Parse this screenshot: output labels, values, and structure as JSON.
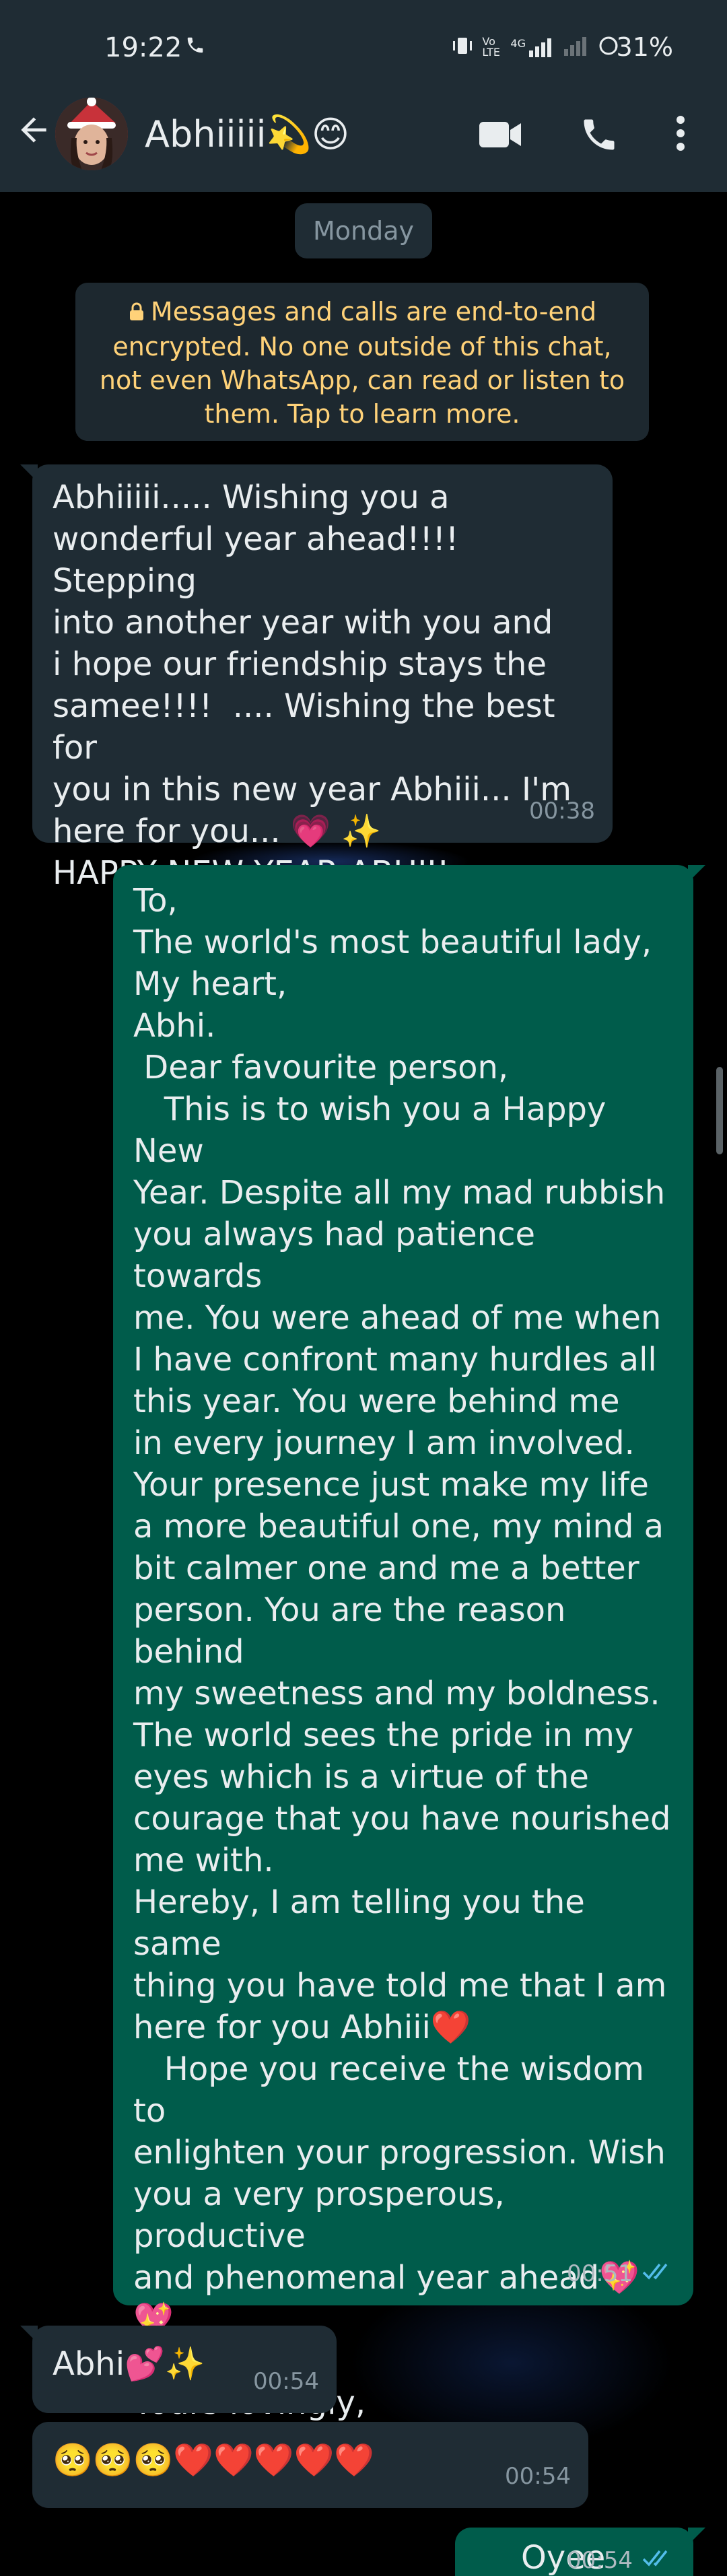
{
  "status_bar": {
    "time": "19:22",
    "network_label": "Vo LTE",
    "signal_label": "4G",
    "battery": "31%"
  },
  "header": {
    "contact_name": "Abhiiiii💫😊"
  },
  "chat": {
    "date_label": "Monday",
    "encryption_notice": "Messages and calls are end-to-end encrypted. No one outside of this chat, not even WhatsApp, can read or listen to them. Tap to learn more.",
    "messages": [
      {
        "direction": "in",
        "text": "Abhiiiii..... Wishing you a\nwonderful year ahead!!!! Stepping\ninto another year with you and\ni hope our friendship stays the\nsamee!!!!  .... Wishing the best for\nyou in this new year Abhiii... I'm\nhere for you... 💗 ✨\nHAPPY NEW YEAR ABHII!",
        "time": "00:38"
      },
      {
        "direction": "out",
        "text": "To,\nThe world's most beautiful lady,\nMy heart,\nAbhi.\n Dear favourite person,\n   This is to wish you a Happy New\nYear. Despite all my mad rubbish\nyou always had patience towards\nme. You were ahead of me when\nI have confront many hurdles all\nthis year. You were behind me\nin every journey I am involved.\nYour presence just make my life\na more beautiful one, my mind a\nbit calmer one and me a better\nperson. You are the reason behind\nmy sweetness and my boldness.\nThe world sees the pride in my\neyes which is a virtue of the\ncourage that you have nourished\nme with.\nHereby, I am telling you the same\nthing you have told me that I am\nhere for you Abhiii❤️\n   Hope you receive the wisdom to\nenlighten your progression. Wish\nyou a very prosperous, productive\nand phenomenal year ahead💖\n💖.\n\nYours lovingly,\n(Fill this)😁",
        "time": "00:51",
        "status": "read"
      },
      {
        "direction": "in",
        "text": "Abhi💕✨",
        "time": "00:54"
      },
      {
        "direction": "in",
        "text": "🥺🥺🥺❤️❤️❤️❤️❤️",
        "time": "00:54"
      },
      {
        "direction": "out",
        "text": "Oyee",
        "time": "00:54",
        "status": "read"
      }
    ]
  },
  "colors": {
    "header_bg": "#1f2c34",
    "incoming_bubble": "#1f2c34",
    "outgoing_bubble": "#005c4b",
    "encryption_text": "#ffd279",
    "read_ticks": "#53bdeb"
  }
}
